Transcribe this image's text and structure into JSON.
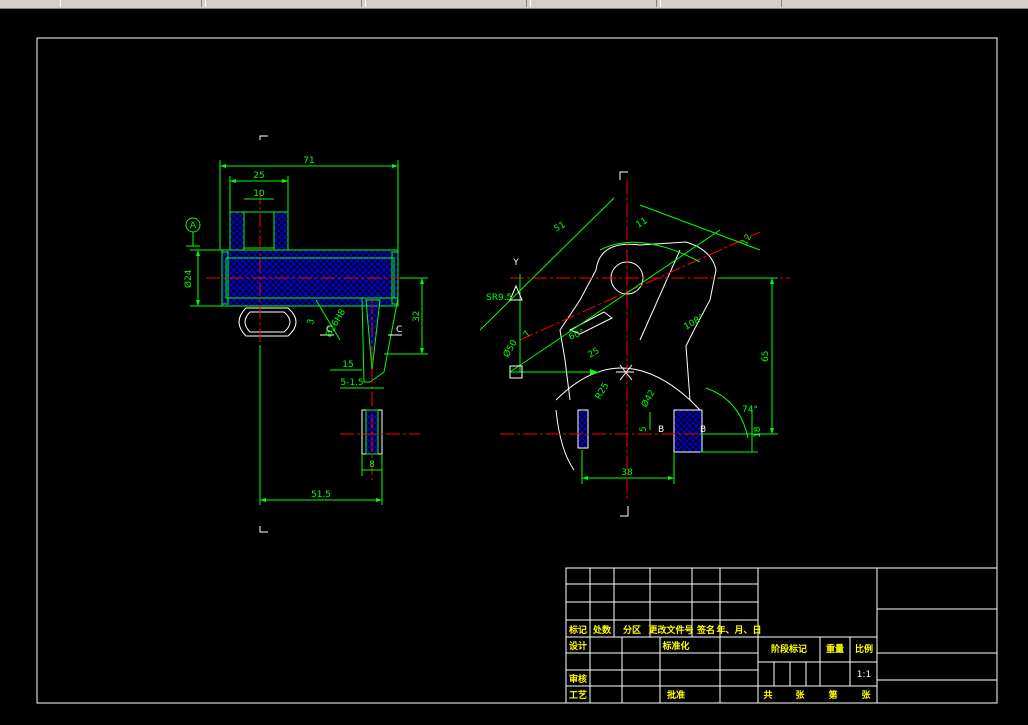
{
  "colors": {
    "background": "#000000",
    "frame": "#ffffff",
    "outline": "#00ff00",
    "centerline": "#ff0000",
    "hatch": "#0000ff",
    "text": "#ffff00"
  },
  "left_view": {
    "dims": {
      "overall_width": "71",
      "width_25": "25",
      "width_10": "10",
      "diameter": "Ø24",
      "height_32": "32",
      "d15": "15",
      "d5_15": "5-1.5",
      "d8": "8",
      "d51_5": "51.5",
      "d3": "3",
      "d_rot": "Ø26H8"
    },
    "datum": "A",
    "section_mark": "C"
  },
  "right_view": {
    "dims": {
      "d51": "51",
      "d11": "11",
      "d12": "12",
      "sr": "SR9.5",
      "d50": "Ø50",
      "d25": "25",
      "d60": "60°",
      "r25": "R25",
      "d42": "Ø42",
      "d65": "65",
      "d74": "74°",
      "d18": "18",
      "d5": "5",
      "d38": "38",
      "d108": "108°",
      "d7": "7"
    },
    "axis_label": "Y",
    "section_mark": "B"
  },
  "title_block": {
    "row_labels": [
      "标记",
      "处数",
      "分区",
      "更改文件号",
      "签名",
      "年、月、日"
    ],
    "design": "设计",
    "standardize": "标准化",
    "review": "审核",
    "process": "工艺",
    "approve": "批准",
    "stage_mark": "阶段标记",
    "weight": "重量",
    "scale_label": "比例",
    "scale_value": "1:1",
    "total": "共",
    "sheet_unit": "张",
    "page": "第",
    "page_unit": "张"
  }
}
